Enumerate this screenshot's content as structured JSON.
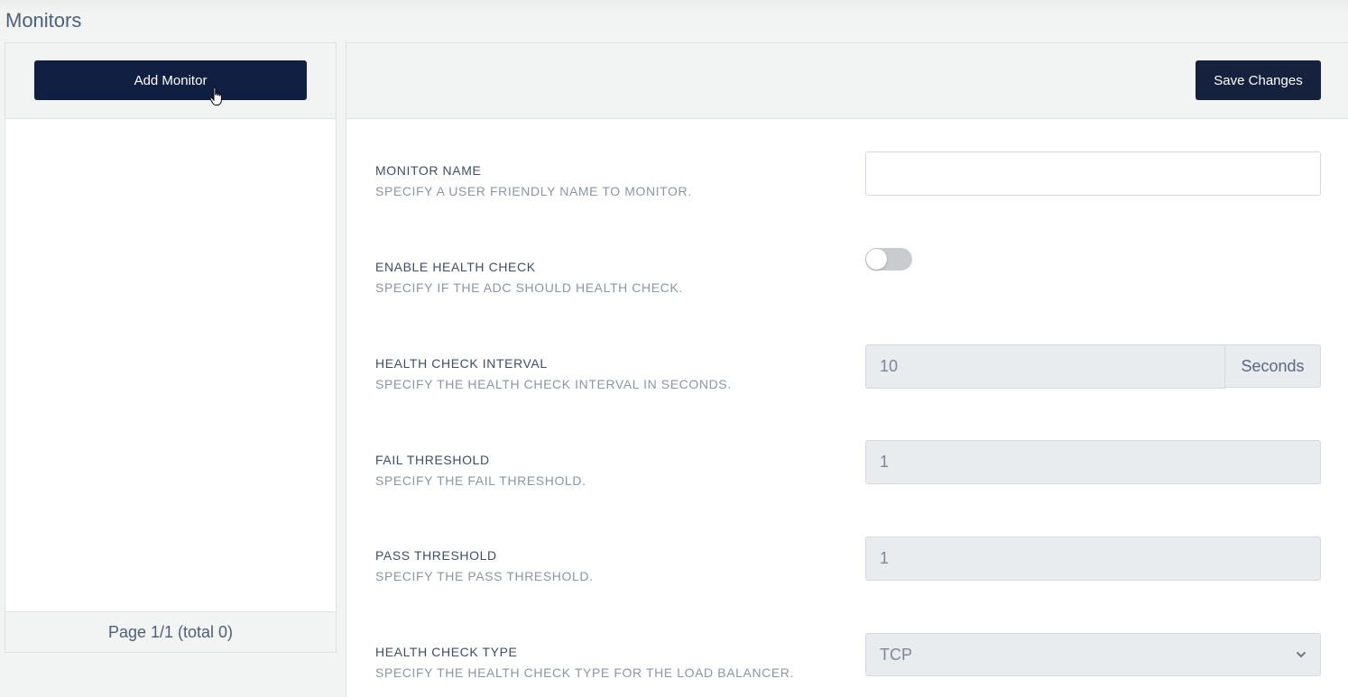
{
  "page": {
    "title": "Monitors"
  },
  "left": {
    "add_button": "Add Monitor",
    "pagination": "Page 1/1 (total 0)"
  },
  "right": {
    "save_button": "Save Changes",
    "fields": {
      "monitor_name": {
        "label": "MONITOR NAME",
        "desc": "SPECIFY A USER FRIENDLY NAME TO MONITOR.",
        "value": ""
      },
      "enable_health_check": {
        "label": "ENABLE HEALTH CHECK",
        "desc": "SPECIFY IF THE ADC SHOULD HEALTH CHECK.",
        "enabled": false
      },
      "health_check_interval": {
        "label": "HEALTH CHECK INTERVAL",
        "desc": "SPECIFY THE HEALTH CHECK INTERVAL IN SECONDS.",
        "value": "10",
        "unit": "Seconds"
      },
      "fail_threshold": {
        "label": "FAIL THRESHOLD",
        "desc": "SPECIFY THE FAIL THRESHOLD.",
        "value": "1"
      },
      "pass_threshold": {
        "label": "PASS THRESHOLD",
        "desc": "SPECIFY THE PASS THRESHOLD.",
        "value": "1"
      },
      "health_check_type": {
        "label": "HEALTH CHECK TYPE",
        "desc": "SPECIFY THE HEALTH CHECK TYPE FOR THE LOAD BALANCER.",
        "value": "TCP"
      }
    }
  },
  "icons": {
    "cursor": "hand-pointer-icon",
    "select_arrow": "chevron-down-icon"
  }
}
